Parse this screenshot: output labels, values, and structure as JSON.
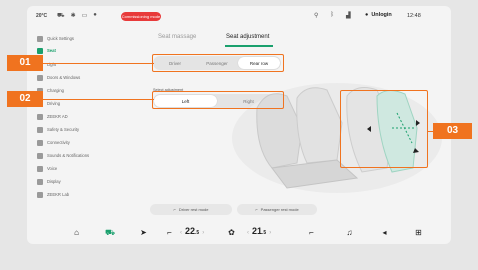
{
  "status_bar": {
    "temperature": "20°C",
    "alert_text": "Commissioning mode",
    "user_name": "Unlogin",
    "time": "12:48"
  },
  "sidebar": {
    "items": [
      {
        "label": "Quick Settings",
        "icon": "toggle-icon"
      },
      {
        "label": "Seat",
        "icon": "seat-icon",
        "active": true
      },
      {
        "label": "Light",
        "icon": "light-icon"
      },
      {
        "label": "Doors & Windows",
        "icon": "door-icon"
      },
      {
        "label": "Charging",
        "icon": "charging-icon"
      },
      {
        "label": "Driving",
        "icon": "car-icon"
      },
      {
        "label": "ZEEKR AD",
        "icon": "ad-icon"
      },
      {
        "label": "Safety & Security",
        "icon": "shield-icon"
      },
      {
        "label": "Connectivity",
        "icon": "wifi-icon"
      },
      {
        "label": "Sounds & Notifications",
        "icon": "speaker-icon"
      },
      {
        "label": "Voice",
        "icon": "mic-icon"
      },
      {
        "label": "Display",
        "icon": "display-icon"
      },
      {
        "label": "ZEEKR Lab",
        "icon": "lab-icon"
      }
    ]
  },
  "tabs": [
    {
      "label": "Seat massage",
      "active": false
    },
    {
      "label": "Seat adjustment",
      "active": true
    }
  ],
  "seat_selector": {
    "options": [
      "Driver",
      "Passenger",
      "Rear row"
    ],
    "selected": "Rear row"
  },
  "side_selector": {
    "label": "Select adjustment",
    "options": [
      "Left",
      "Right"
    ],
    "selected": "Left"
  },
  "bottom_buttons": {
    "driver_rest": "Driver rest mode",
    "passenger_rest": "Passenger rest mode"
  },
  "dock": {
    "left_temp": "22",
    "left_temp_decimal": ".5",
    "right_temp": "21",
    "right_temp_decimal": ".5"
  },
  "callouts": [
    "01",
    "02",
    "03"
  ],
  "colors": {
    "accent": "#1aa06d",
    "callout": "#f0731f",
    "alert": "#e83a3a"
  }
}
